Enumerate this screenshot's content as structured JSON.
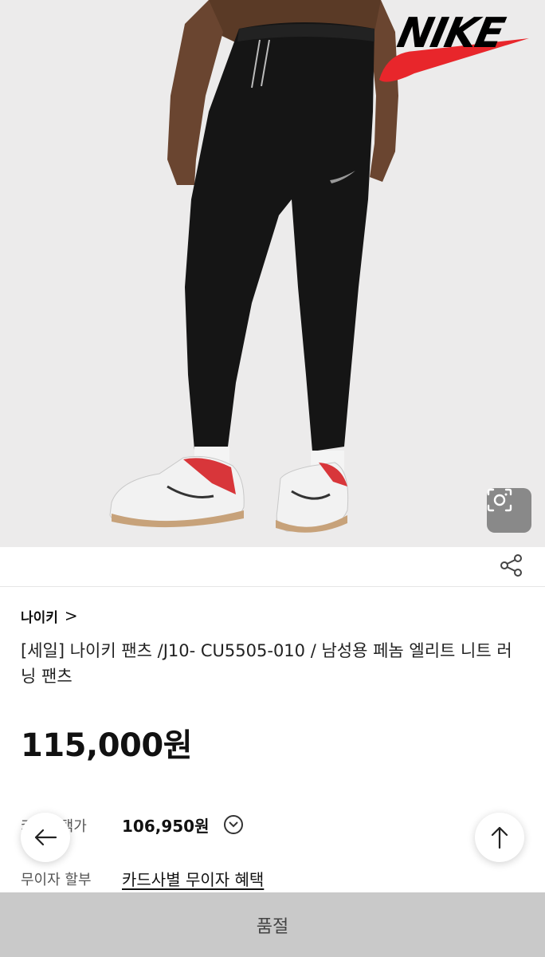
{
  "hero": {
    "brand_logo_text": "NIKE",
    "swoosh_color": "#e8262b",
    "background_color": "#ecebeb",
    "lens_icon": "camera-search-icon"
  },
  "actions": {
    "share_icon": "share-icon"
  },
  "product": {
    "brand": "나이키",
    "brand_chevron": ">",
    "title": "[세일] 나이키 팬츠 /J10- CU5505-010 / 남성용 페놈 엘리트 니트 러닝 팬츠",
    "price": "115,000원"
  },
  "card_benefit": {
    "label": "카드혜택가",
    "price": "106,950원",
    "expand_icon": "chevron-down-circle-icon"
  },
  "installment": {
    "label": "무이자 할부",
    "link": "카드사별 무이자 혜택"
  },
  "floating": {
    "back_icon": "arrow-left-icon",
    "top_icon": "arrow-up-icon"
  },
  "bottom_bar": {
    "label": "품절"
  }
}
